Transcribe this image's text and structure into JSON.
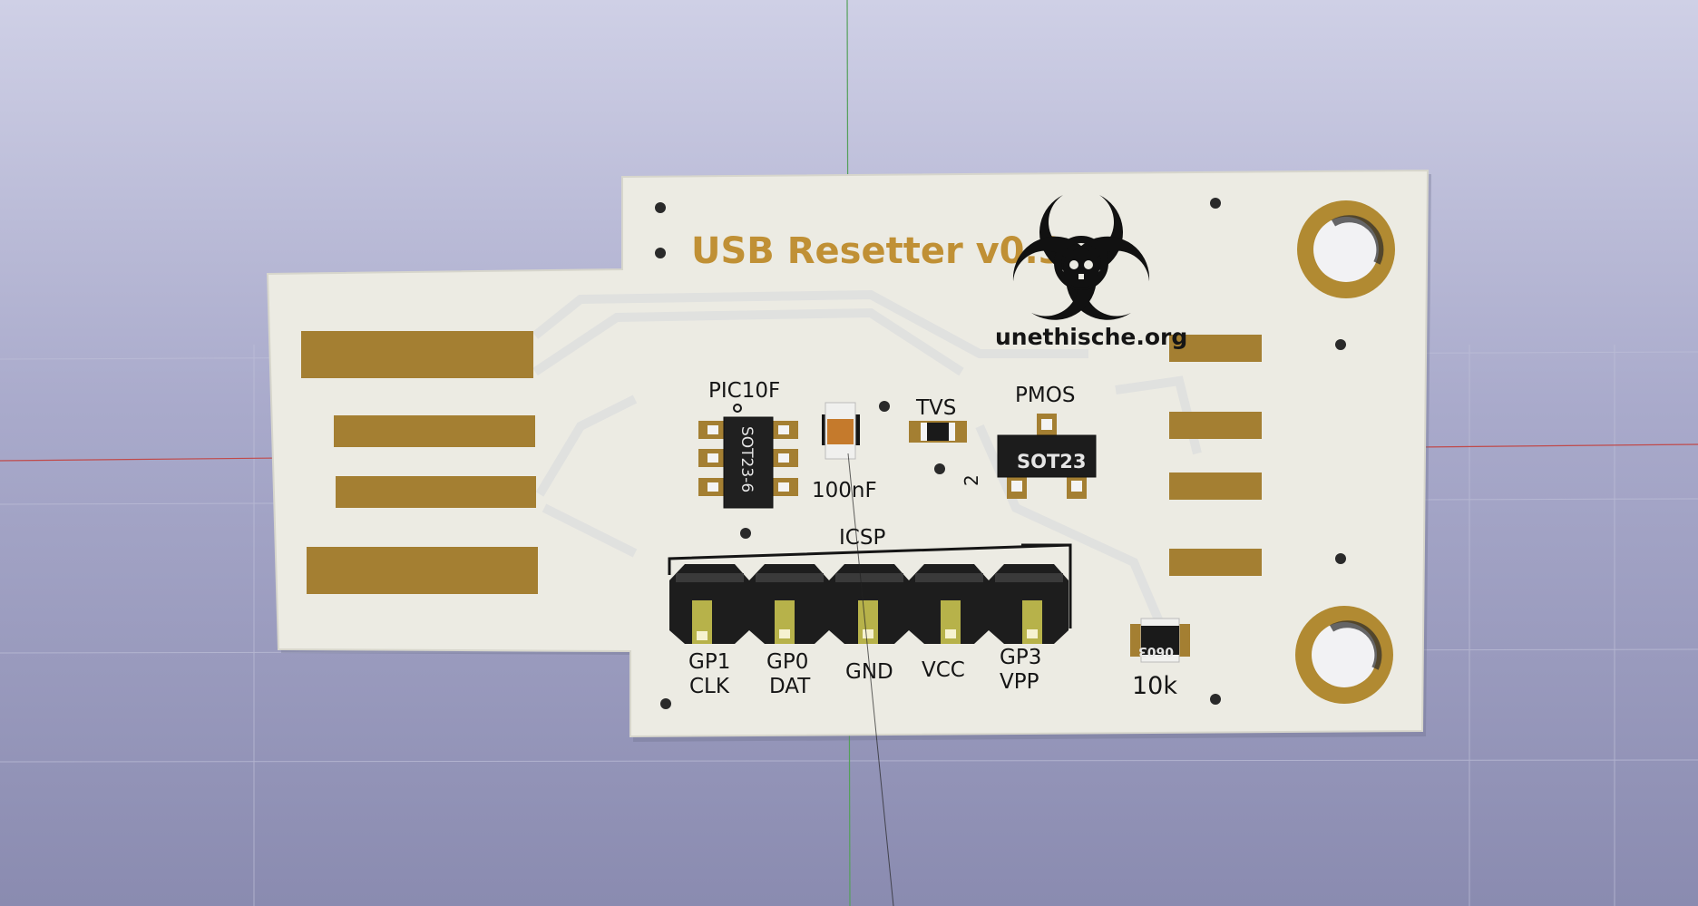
{
  "board": {
    "title": "USB Resetter v0.3",
    "website": "unethische.org",
    "logo_icon": "biohazard-skull-icon"
  },
  "components": {
    "mcu_label": "PIC10F",
    "mcu_package": "SOT23-6",
    "cap_value": "100nF",
    "tvs_label": "TVS",
    "pmos_label": "PMOS",
    "pmos_package": "SOT23",
    "pmos_pin_mark": "2",
    "resistor_value": "10k",
    "resistor_package": "0603"
  },
  "header": {
    "label": "ICSP",
    "pins": [
      {
        "line1": "GP1",
        "line2": "CLK"
      },
      {
        "line1": "GP0",
        "line2": "DAT"
      },
      {
        "line1": "GND",
        "line2": ""
      },
      {
        "line1": "VCC",
        "line2": ""
      },
      {
        "line1": "GP3",
        "line2": "VPP"
      }
    ]
  },
  "colors": {
    "background": "#a9aacb",
    "board": "#ecebe3",
    "copper": "#a47f32",
    "silkscreen": "#151515",
    "title": "#c09035"
  }
}
